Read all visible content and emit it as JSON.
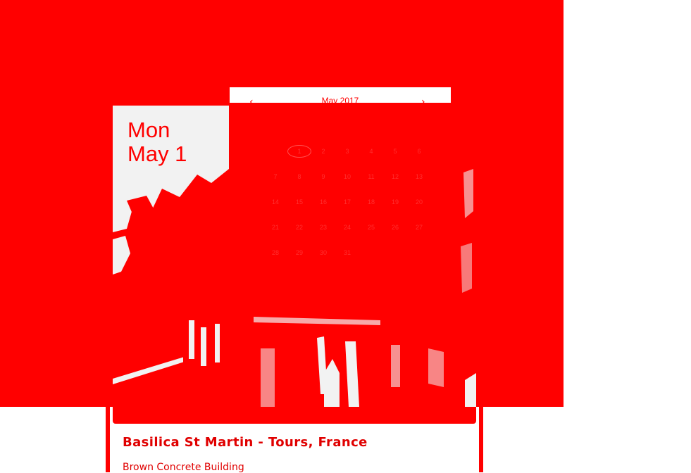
{
  "site": {
    "title": ""
  },
  "date": {
    "weekday": "Mon",
    "month_day": "May 1",
    "small": ""
  },
  "calendar": {
    "month_label": "May 2017",
    "prev_icon": "chevron-left-icon",
    "next_icon": "chevron-right-icon",
    "prev_glyph": "‹",
    "next_glyph": "›",
    "days_of_week": [
      "",
      "",
      "",
      "",
      "",
      "",
      ""
    ],
    "weeks": [
      [
        "",
        "1",
        "2",
        "3",
        "4",
        "5",
        "6"
      ],
      [
        "7",
        "8",
        "9",
        "10",
        "11",
        "12",
        "13"
      ],
      [
        "14",
        "15",
        "16",
        "17",
        "18",
        "19",
        "20"
      ],
      [
        "21",
        "22",
        "23",
        "24",
        "25",
        "26",
        "27"
      ],
      [
        "28",
        "29",
        "30",
        "31",
        "",
        "",
        ""
      ]
    ],
    "today": "1"
  },
  "card": {
    "title": "Basilica St Martin - Tours, France",
    "subtitle": "Brown Concrete Building"
  },
  "colors": {
    "primary": "#ff0000",
    "background": "#ffffff",
    "accent_text": "#e00000"
  }
}
